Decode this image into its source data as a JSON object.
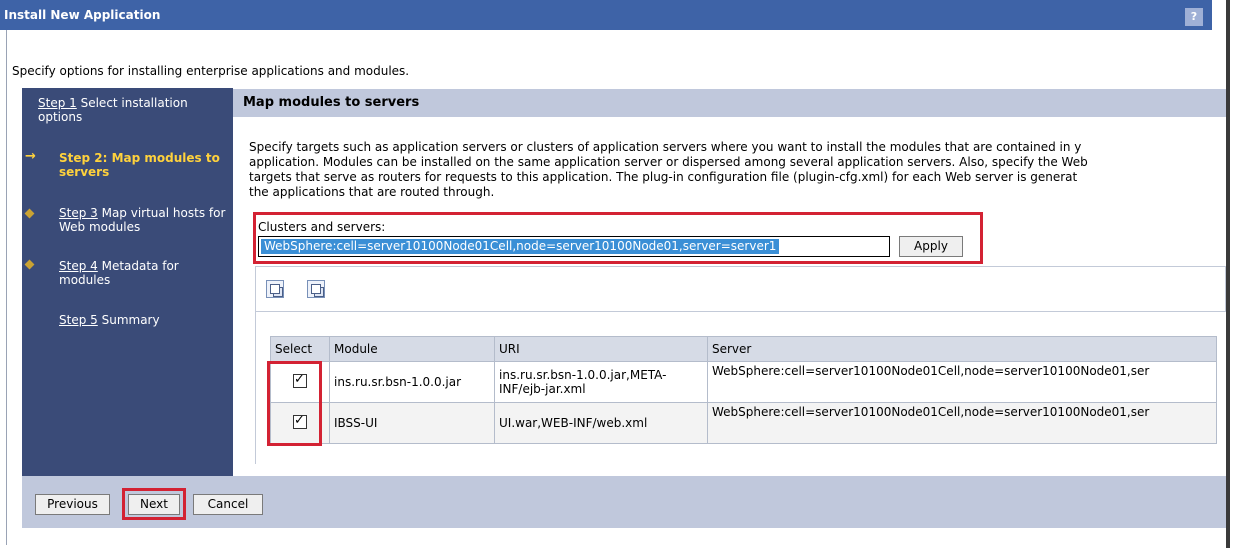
{
  "window": {
    "title": "Install New Application",
    "help_label": "?"
  },
  "intro": "Specify options for installing enterprise applications and modules.",
  "steps": [
    {
      "num": "Step 1",
      "text": " Select installation options",
      "line2": "installation options"
    },
    {
      "label": "Step 2: Map modules to servers"
    },
    {
      "num": "Step 3",
      "text": " Map virtual hosts for Web modules"
    },
    {
      "num": "Step 4",
      "text": " Metadata for modules"
    },
    {
      "num": "Step 5",
      "text": " Summary"
    }
  ],
  "main": {
    "header": "Map modules to servers",
    "description": [
      "Specify targets such as application servers or clusters of application servers where you want to install the modules that are contained in y",
      "application. Modules can be installed on the same application server or dispersed among several application servers. Also, specify the Web",
      "targets that serve as routers for requests to this application. The plug-in configuration file (plugin-cfg.xml) for each Web server is generat",
      "the applications that are routed through."
    ],
    "clusters_label": "Clusters and servers:",
    "clusters_value": "WebSphere:cell=server10100Node01Cell,node=server10100Node01,server=server1",
    "apply_label": "Apply"
  },
  "table": {
    "headers": [
      "Select",
      "Module",
      "URI",
      "Server"
    ],
    "rows": [
      {
        "checked": true,
        "module": "ins.ru.sr.bsn-1.0.0.jar",
        "uri": "ins.ru.sr.bsn-1.0.0.jar,META-INF/ejb-jar.xml",
        "server": "WebSphere:cell=server10100Node01Cell,node=server10100Node01,ser"
      },
      {
        "checked": true,
        "module": "IBSS-UI",
        "uri": "UI.war,WEB-INF/web.xml",
        "server": "WebSphere:cell=server10100Node01Cell,node=server10100Node01,ser"
      }
    ]
  },
  "buttons": {
    "previous": "Previous",
    "next": "Next",
    "cancel": "Cancel"
  },
  "colors": {
    "title_bar": "#3e63a7",
    "sidebar": "#3a4b78",
    "current_step": "#ffd23c",
    "highlight_box": "#d32233",
    "panel": "#c0c8dc"
  }
}
